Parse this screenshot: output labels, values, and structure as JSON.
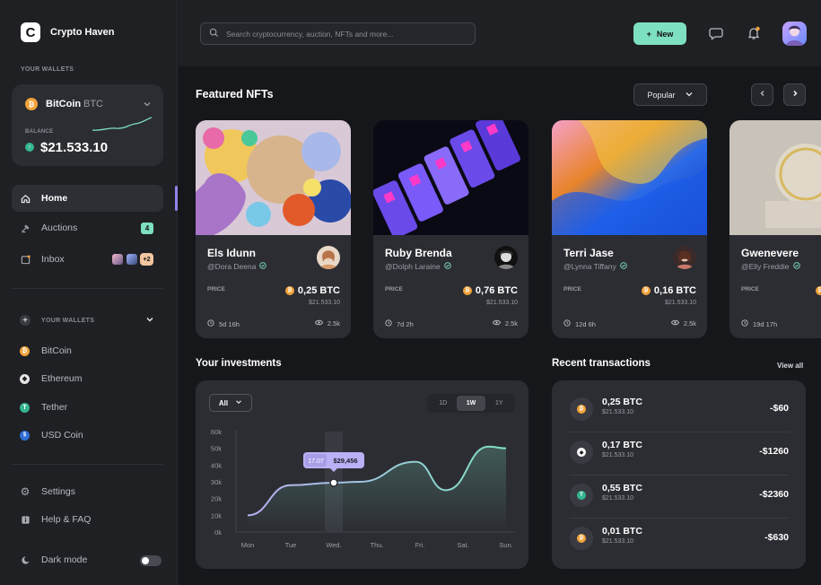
{
  "brand": {
    "name": "Crypto Haven",
    "logo_letter": "C"
  },
  "sidebar": {
    "wallets_label": "YOUR WALLETS",
    "wallet_card": {
      "coin": "BitCoin",
      "ticker": "BTC",
      "balance_label": "BALANCE",
      "balance": "$21.533.10"
    },
    "nav": [
      {
        "label": "Home",
        "icon": "home-icon",
        "active": true
      },
      {
        "label": "Auctions",
        "icon": "auction-icon",
        "badge": "4"
      },
      {
        "label": "Inbox",
        "icon": "inbox-icon",
        "extra": "+2"
      }
    ],
    "wallets_section_label": "YOUR WALLETS",
    "wallets": [
      {
        "label": "BitCoin",
        "icon": "bitcoin-icon"
      },
      {
        "label": "Ethereum",
        "icon": "ethereum-icon"
      },
      {
        "label": "Tether",
        "icon": "tether-icon"
      },
      {
        "label": "USD Coin",
        "icon": "usd-coin-icon"
      }
    ],
    "settings_label": "Settings",
    "help_label": "Help & FAQ",
    "dark_mode_label": "Dark mode"
  },
  "topbar": {
    "search_placeholder": "Search cryptocurrency, auction, NFTs and more...",
    "new_label": "New"
  },
  "featured": {
    "title": "Featured NFTs",
    "sort_label": "Popular",
    "cards": [
      {
        "name": "Els Idunn",
        "handle": "@Dora Deena",
        "price_label": "PRICE",
        "price": "0,25 BTC",
        "usd": "$21.533.10",
        "time": "5d 16h",
        "views": "2.5k"
      },
      {
        "name": "Ruby Brenda",
        "handle": "@Dolph Laraine",
        "price_label": "PRICE",
        "price": "0,76 BTC",
        "usd": "$21.533.10",
        "time": "7d 2h",
        "views": "2.5k"
      },
      {
        "name": "Terri Jase",
        "handle": "@Lynna Tiffany",
        "price_label": "PRICE",
        "price": "0,16 BTC",
        "usd": "$21.533.10",
        "time": "12d 6h",
        "views": "2.5k"
      },
      {
        "name": "Gwenevere",
        "handle": "@Elly Freddie",
        "price_label": "PRICE",
        "price": "",
        "usd": "",
        "time": "19d 17h",
        "views": ""
      }
    ]
  },
  "investments": {
    "title": "Your investments",
    "filter_label": "All",
    "ranges": [
      "1D",
      "1W",
      "1Y"
    ],
    "active_range": "1W",
    "tooltip": {
      "date": "17.07",
      "value": "$29,456"
    }
  },
  "transactions": {
    "title": "Recent transactions",
    "view_all": "View all",
    "rows": [
      {
        "amount": "0,25 BTC",
        "usd": "$21.533.10",
        "value": "-$60",
        "icon": "bitcoin-icon"
      },
      {
        "amount": "0,17 BTC",
        "usd": "$21.533.10",
        "value": "-$1260",
        "icon": "ethereum-icon"
      },
      {
        "amount": "0,55 BTC",
        "usd": "$21.533.10",
        "value": "-$2360",
        "icon": "tether-icon"
      },
      {
        "amount": "0,01 BTC",
        "usd": "$21.533.10",
        "value": "-$630",
        "icon": "bitcoin-icon"
      }
    ]
  },
  "chart_data": {
    "type": "line",
    "categories": [
      "Mon",
      "Tue",
      "Wed.",
      "Thu.",
      "Fri.",
      "Sat.",
      "Sun."
    ],
    "y_ticks": [
      "60k",
      "50k",
      "40k",
      "30k",
      "20k",
      "10k",
      "0k"
    ],
    "ylim": [
      0,
      60000
    ],
    "series": [
      {
        "values": [
          10000,
          28000,
          29456,
          30000,
          42000,
          25000,
          51000,
          50000
        ]
      }
    ],
    "x_points": [
      0,
      1,
      2,
      2.6,
      3.9,
      4.6,
      5.6,
      6
    ],
    "highlight_index": 2,
    "line_color": "#7ee0c2"
  }
}
